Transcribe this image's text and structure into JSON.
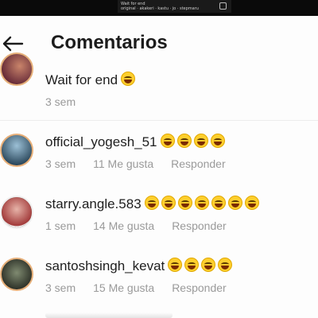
{
  "video_overlay": {
    "text_line1": "Wait for end",
    "text_line2": "original · akakeri · kastu · jo · stepmaru"
  },
  "header": {
    "title": "Comentarios",
    "back_icon": "arrow-left-icon"
  },
  "comments": [
    {
      "username": "",
      "text": "Wait for end",
      "emoji_count": 1,
      "time": "3 sem",
      "likes": "",
      "reply": ""
    },
    {
      "username": "official_yogesh_51",
      "text": "",
      "emoji_count": 4,
      "time": "3 sem",
      "likes": "11 Me gusta",
      "reply": "Responder"
    },
    {
      "username": "starry.angle.583",
      "text": "",
      "emoji_count": 7,
      "time": "1 sem",
      "likes": "14 Me gusta",
      "reply": "Responder"
    },
    {
      "username": "santoshsingh_kevat",
      "text": "",
      "emoji_count": 4,
      "time": "3 sem",
      "likes": "15 Me gusta",
      "reply": "Responder"
    }
  ],
  "colors": {
    "background": "#fdfdfd",
    "meta_text": "#9a9a9a",
    "emoji": "#ffcf2e",
    "avatar_ring": "#e7b07a"
  }
}
